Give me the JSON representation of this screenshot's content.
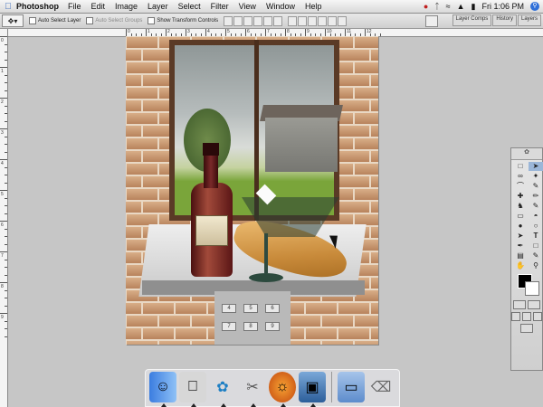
{
  "menubar": {
    "app": "Photoshop",
    "items": [
      "File",
      "Edit",
      "Image",
      "Layer",
      "Select",
      "Filter",
      "View",
      "Window",
      "Help"
    ],
    "clock": "Fri 1:06 PM"
  },
  "options": {
    "auto_select_layer": "Auto Select Layer",
    "auto_select_groups": "Auto Select Groups",
    "show_transform_controls": "Show Transform Controls",
    "palette_tabs": [
      "Layer Comps",
      "History",
      "Layers"
    ]
  },
  "ruler": {
    "h_numbers": [
      "0",
      "1",
      "2",
      "3",
      "4",
      "5",
      "6",
      "7",
      "8",
      "9",
      "10",
      "11",
      "12"
    ],
    "v_numbers": [
      "0",
      "1",
      "2",
      "3",
      "4",
      "5",
      "6",
      "7",
      "8",
      "9"
    ]
  },
  "phone_keys": [
    "4",
    "5",
    "6",
    "7",
    "8",
    "9"
  ],
  "dock": {
    "items": [
      "Finder",
      "System Preferences",
      "Mail",
      "Scissors",
      "Firefox",
      "Preview",
      "Folder",
      "Trash"
    ]
  },
  "colors": {
    "foreground": "#000000",
    "background": "#ffffff",
    "accent": "#2e6fd8"
  }
}
